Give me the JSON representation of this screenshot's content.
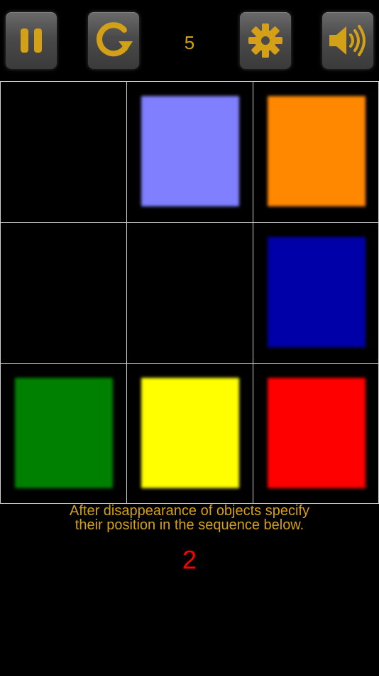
{
  "toolbar": {
    "level": "5",
    "icon_color": "#d4a017"
  },
  "grid": {
    "rows": 3,
    "cols": 3,
    "cells": [
      {
        "row": 0,
        "col": 0,
        "color": null
      },
      {
        "row": 0,
        "col": 1,
        "color": "#8080ff"
      },
      {
        "row": 0,
        "col": 2,
        "color": "#ff8800"
      },
      {
        "row": 1,
        "col": 0,
        "color": null
      },
      {
        "row": 1,
        "col": 1,
        "color": null
      },
      {
        "row": 1,
        "col": 2,
        "color": "#0000a8"
      },
      {
        "row": 2,
        "col": 0,
        "color": "#008000"
      },
      {
        "row": 2,
        "col": 1,
        "color": "#ffff00"
      },
      {
        "row": 2,
        "col": 2,
        "color": "#ff0000"
      }
    ]
  },
  "instructions": {
    "line1": "After disappearance of objects specify",
    "line2": "their position in the sequence below."
  },
  "counter": "2"
}
